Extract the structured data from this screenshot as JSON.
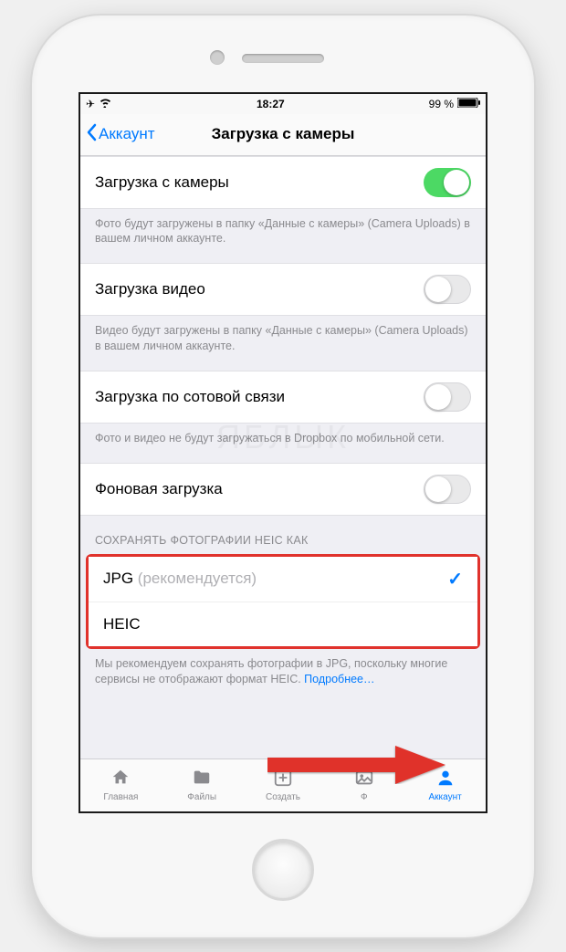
{
  "statusbar": {
    "time": "18:27",
    "battery": "99 %"
  },
  "nav": {
    "back": "Аккаунт",
    "title": "Загрузка с камеры"
  },
  "rows": {
    "camera_upload": "Загрузка с камеры",
    "camera_upload_footer": "Фото будут загружены в папку «Данные с камеры» (Camera Uploads) в вашем личном аккаунте.",
    "video_upload": "Загрузка видео",
    "video_upload_footer": "Видео будут загружены в папку «Данные с камеры» (Camera Uploads) в вашем личном аккаунте.",
    "cellular": "Загрузка по сотовой связи",
    "cellular_footer": "Фото и видео не будут загружаться в Dropbox по мобильной сети.",
    "background": "Фоновая загрузка"
  },
  "heic": {
    "header": "СОХРАНЯТЬ ФОТОГРАФИИ HEIC КАК",
    "jpg": "JPG",
    "jpg_rec": "(рекомендуется)",
    "heic": "HEIC",
    "footer_a": "Мы рекомендуем сохранять фотографии в JPG, поскольку многие сервисы не отображают формат HEIC. ",
    "footer_link": "Подробнее…"
  },
  "tabs": {
    "home": "Главная",
    "files": "Файлы",
    "create": "Создать",
    "photos": "Ф",
    "account": "Аккаунт"
  },
  "watermark": "ЯБЛЫК"
}
